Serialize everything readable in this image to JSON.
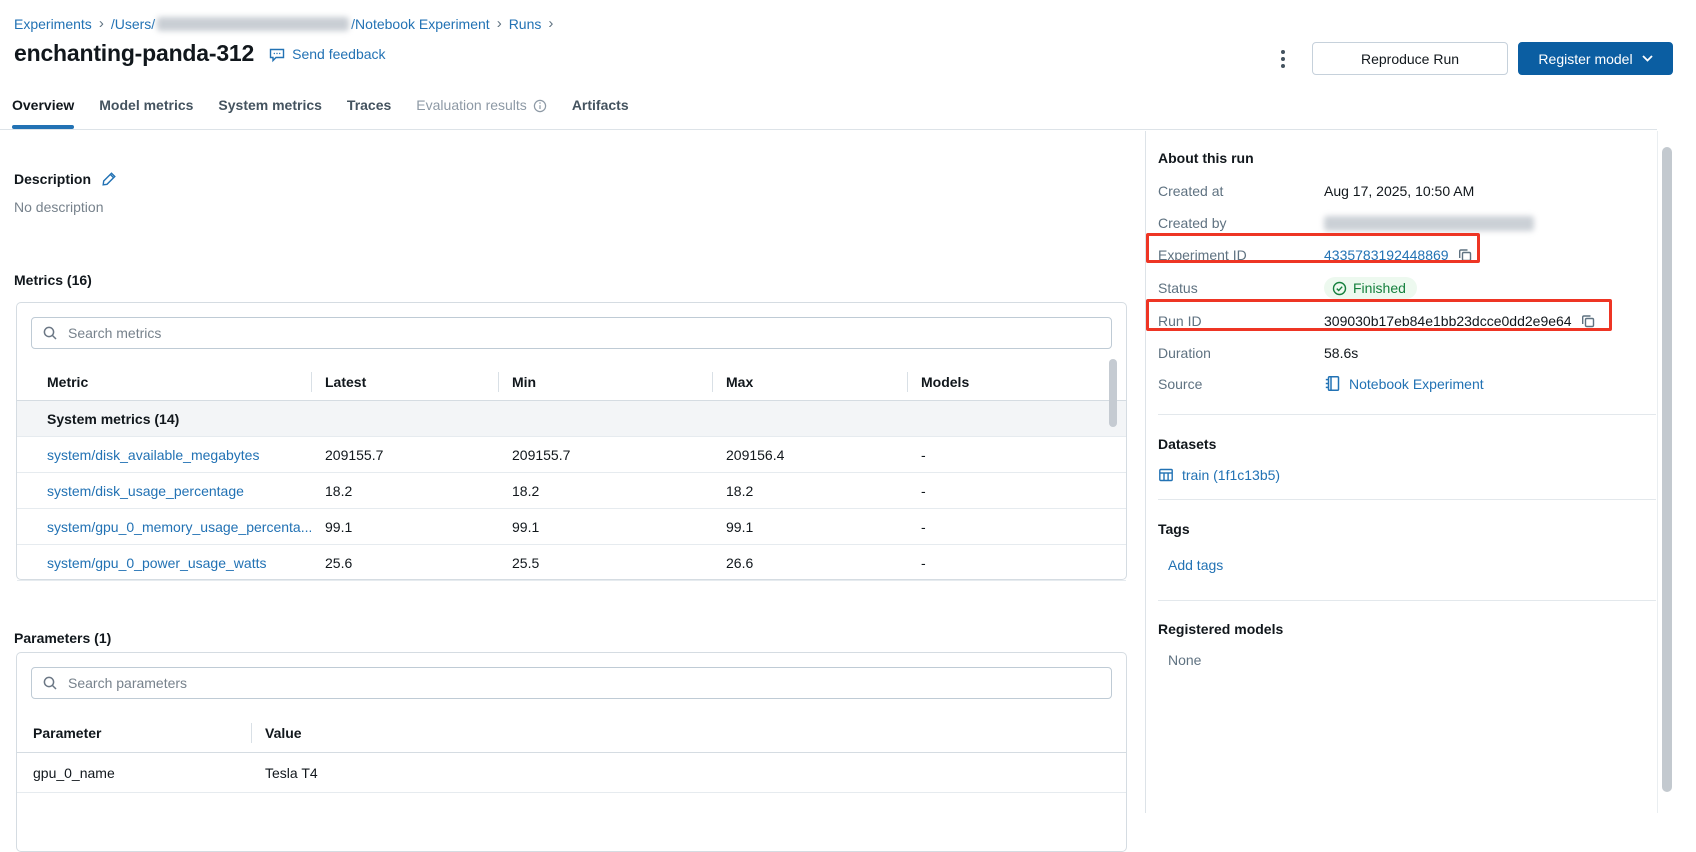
{
  "breadcrumb": {
    "experiments": "Experiments",
    "separator": "›",
    "path_prefix": "/Users/",
    "path_redacted": "(redacted user path)",
    "path_suffix": "/Notebook Experiment",
    "runs": "Runs"
  },
  "header": {
    "title": "enchanting-panda-312",
    "send_feedback": "Send feedback",
    "reproduce_run": "Reproduce Run",
    "register_model": "Register model"
  },
  "tabs": [
    {
      "label": "Overview",
      "state": "active"
    },
    {
      "label": "Model metrics",
      "state": "normal"
    },
    {
      "label": "System metrics",
      "state": "normal"
    },
    {
      "label": "Traces",
      "state": "normal"
    },
    {
      "label": "Evaluation results",
      "state": "disabled"
    },
    {
      "label": "Artifacts",
      "state": "normal"
    }
  ],
  "description": {
    "heading": "Description",
    "empty_text": "No description"
  },
  "metrics": {
    "heading": "Metrics (16)",
    "search_placeholder": "Search metrics",
    "columns": [
      "Metric",
      "Latest",
      "Min",
      "Max",
      "Models"
    ],
    "group_header": "System metrics (14)",
    "rows": [
      {
        "name": "system/disk_available_megabytes",
        "latest": "209155.7",
        "min": "209155.7",
        "max": "209156.4",
        "models": "-"
      },
      {
        "name": "system/disk_usage_percentage",
        "latest": "18.2",
        "min": "18.2",
        "max": "18.2",
        "models": "-"
      },
      {
        "name": "system/gpu_0_memory_usage_percenta...",
        "latest": "99.1",
        "min": "99.1",
        "max": "99.1",
        "models": "-"
      },
      {
        "name": "system/gpu_0_power_usage_watts",
        "latest": "25.6",
        "min": "25.5",
        "max": "26.6",
        "models": "-"
      }
    ]
  },
  "parameters": {
    "heading": "Parameters (1)",
    "search_placeholder": "Search parameters",
    "columns": [
      "Parameter",
      "Value"
    ],
    "rows": [
      {
        "name": "gpu_0_name",
        "value": "Tesla T4"
      }
    ]
  },
  "sidebar": {
    "about_heading": "About this run",
    "created_at_label": "Created at",
    "created_at": "Aug 17, 2025, 10:50 AM",
    "created_by_label": "Created by",
    "experiment_id_label": "Experiment ID",
    "experiment_id": "4335783192448869",
    "status_label": "Status",
    "status": "Finished",
    "run_id_label": "Run ID",
    "run_id": "309030b17eb84e1bb23dcce0dd2e9e64",
    "duration_label": "Duration",
    "duration": "58.6s",
    "source_label": "Source",
    "source": "Notebook Experiment",
    "datasets_heading": "Datasets",
    "dataset_link": "train (1f1c13b5)",
    "tags_heading": "Tags",
    "add_tags": "Add tags",
    "registered_heading": "Registered models",
    "registered_none": "None"
  },
  "colors": {
    "link": "#2272B4",
    "primary_button": "#0B5EA2",
    "success_text": "#15803D",
    "annotation": "#EE3524"
  }
}
